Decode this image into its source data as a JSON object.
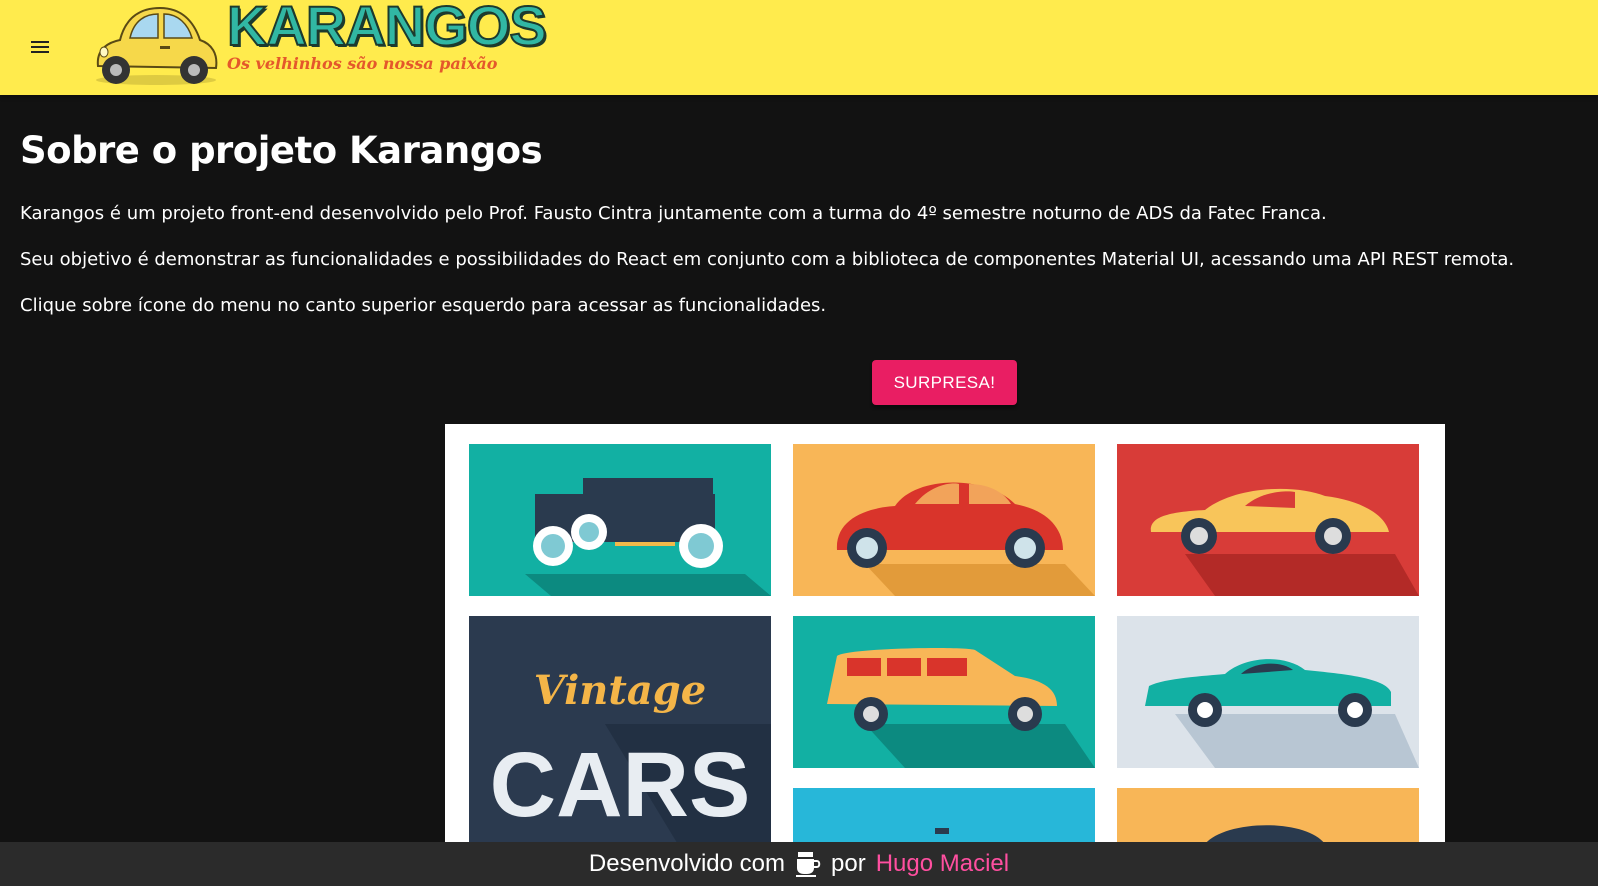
{
  "header": {
    "menu_icon": "menu-icon",
    "logo_title": "KARANGOS",
    "logo_tagline": "Os velhinhos são nossa paixão"
  },
  "main": {
    "title": "Sobre o projeto Karangos",
    "paragraphs": [
      "Karangos é um projeto front-end desenvolvido pelo Prof. Fausto Cintra juntamente com a turma do 4º semestre noturno de ADS da Fatec Franca.",
      "Seu objetivo é demonstrar as funcionalidades e possibilidades do React em conjunto com a biblioteca de componentes Material UI, acessando uma API REST remota.",
      "Clique sobre ícone do menu no canto superior esquerdo para acessar as funcionalidades."
    ],
    "surprise_button": "SURPRESA!",
    "poster": {
      "word_script": "Vintage",
      "word_block": "CARS"
    }
  },
  "footer": {
    "text_before": "Desenvolvido com",
    "icon": "coffee-icon",
    "text_between": "por",
    "author": "Hugo Maciel"
  },
  "colors": {
    "appbar": "#ffeb4d",
    "background": "#121212",
    "accent": "#e91e63",
    "footer": "#2b2b2b",
    "author_link": "#ff4fa0"
  }
}
